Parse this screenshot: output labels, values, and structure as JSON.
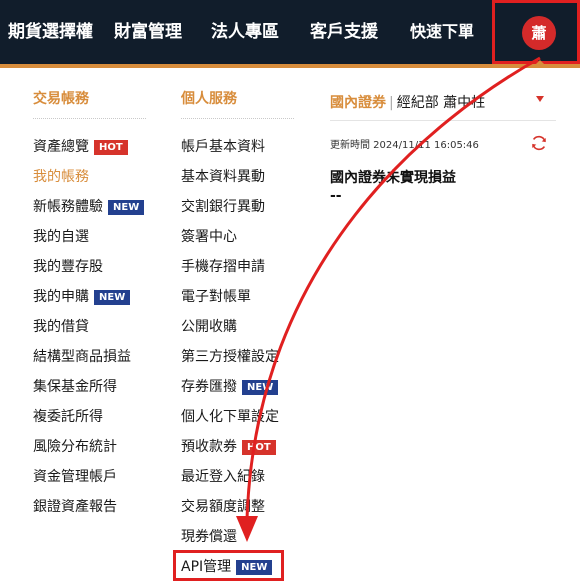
{
  "nav": {
    "items": [
      "期貨選擇權",
      "財富管理",
      "法人專區",
      "客戶支援",
      "快速下單"
    ],
    "avatar_text": "蕭"
  },
  "columns": {
    "trading": {
      "title": "交易帳務",
      "items": [
        {
          "label": "資產總覽",
          "badge": "HOT"
        },
        {
          "label": "我的帳務",
          "active": true
        },
        {
          "label": "新帳務體驗",
          "badge": "NEW"
        },
        {
          "label": "我的自選"
        },
        {
          "label": "我的豐存股"
        },
        {
          "label": "我的申購",
          "badge": "NEW"
        },
        {
          "label": "我的借貸"
        },
        {
          "label": "結構型商品損益"
        },
        {
          "label": "集保基金所得"
        },
        {
          "label": "複委託所得"
        },
        {
          "label": "風險分布統計"
        },
        {
          "label": "資金管理帳戶"
        },
        {
          "label": "銀證資產報告"
        }
      ]
    },
    "personal": {
      "title": "個人服務",
      "items": [
        {
          "label": "帳戶基本資料"
        },
        {
          "label": "基本資料異動"
        },
        {
          "label": "交割銀行異動"
        },
        {
          "label": "簽署中心"
        },
        {
          "label": "手機存摺申請"
        },
        {
          "label": "電子對帳單"
        },
        {
          "label": "公開收購"
        },
        {
          "label": "第三方授權設定"
        },
        {
          "label": "存券匯撥",
          "badge": "NEW"
        },
        {
          "label": "個人化下單設定"
        },
        {
          "label": "預收款券",
          "badge": "HOT"
        },
        {
          "label": "最近登入紀錄"
        },
        {
          "label": "交易額度調整"
        },
        {
          "label": "現券償還"
        },
        {
          "label": "API管理",
          "badge": "NEW"
        }
      ]
    }
  },
  "account_panel": {
    "market": "國內證券",
    "separator": "|",
    "account": "經紀部 蕭中柱",
    "update_time": "更新時間 2024/11/11 16:05:46",
    "unrealized_title": "國內證券未實現損益",
    "unrealized_value": "--"
  },
  "colors": {
    "nav_bg": "#111d2b",
    "accent": "#d88d3c",
    "hot": "#d6332b",
    "new": "#23408f",
    "annotation": "#e02020"
  }
}
